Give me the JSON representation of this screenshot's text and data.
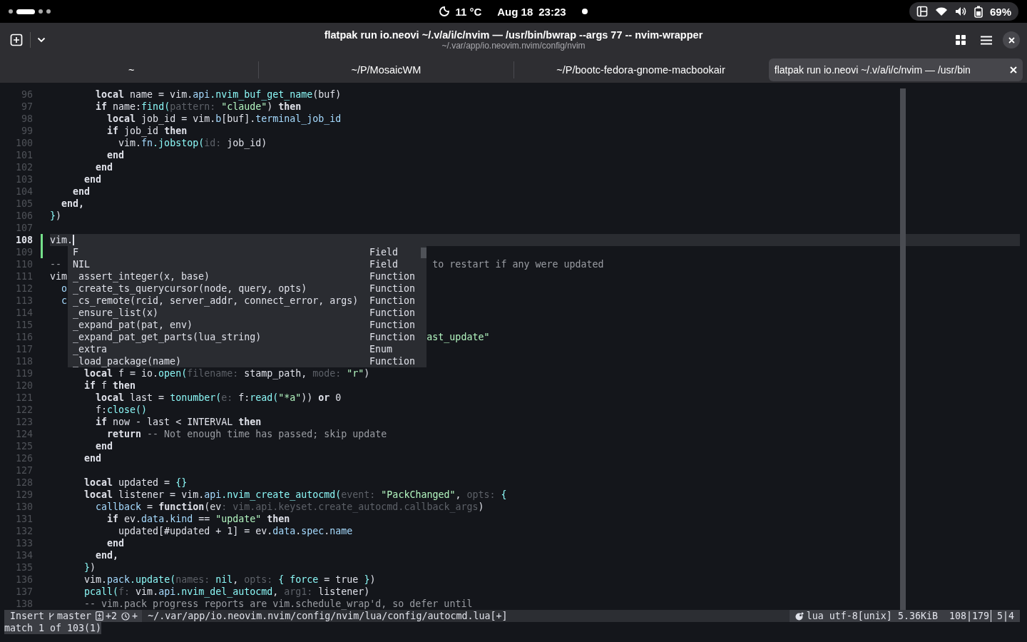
{
  "top_bar": {
    "weather": "11 °C",
    "date": "Aug 18",
    "time": "23:23",
    "battery": "69%"
  },
  "window": {
    "title": "flatpak run io.neovi ~/.v/a/i/c/nvim — /usr/bin/bwrap --args 77 -- nvim-wrapper",
    "subtitle": "~/.var/app/io.neovim.nvim/config/nvim"
  },
  "tabs": [
    {
      "label": "~",
      "selected": false
    },
    {
      "label": "~/P/MosaicWM",
      "selected": false
    },
    {
      "label": "~/P/bootc-fedora-gnome-macbookair",
      "selected": false
    },
    {
      "label": "flatpak run io.neovi ~/.v/a/i/c/nvim — /usr/bin",
      "selected": true
    }
  ],
  "editor": {
    "lines": [
      {
        "n": "96",
        "current": false,
        "added": false,
        "tokens": [
          {
            "kind": "kw",
            "text": "        local"
          },
          {
            "kind": "plain",
            "text": " name = vim."
          },
          {
            "kind": "field",
            "text": "api"
          },
          {
            "kind": "fn",
            "text": ".nvim_buf_get_name"
          },
          {
            "kind": "plain",
            "text": "(buf)"
          }
        ]
      },
      {
        "n": "97",
        "current": false,
        "added": false,
        "tokens": [
          {
            "kind": "kw",
            "text": "        if"
          },
          {
            "kind": "plain",
            "text": " name:"
          },
          {
            "kind": "fn",
            "text": "find("
          },
          {
            "kind": "hint",
            "text": "pattern: "
          },
          {
            "kind": "str",
            "text": "\"claude\""
          },
          {
            "kind": "plain",
            "text": ") "
          },
          {
            "kind": "kw",
            "text": "then"
          }
        ]
      },
      {
        "n": "98",
        "current": false,
        "added": false,
        "tokens": [
          {
            "kind": "kw",
            "text": "          local"
          },
          {
            "kind": "plain",
            "text": " job_id = vim."
          },
          {
            "kind": "field",
            "text": "b"
          },
          {
            "kind": "plain",
            "text": "[buf]."
          },
          {
            "kind": "field",
            "text": "terminal_job_id"
          }
        ]
      },
      {
        "n": "99",
        "current": false,
        "added": false,
        "tokens": [
          {
            "kind": "kw",
            "text": "          if"
          },
          {
            "kind": "plain",
            "text": " job_id "
          },
          {
            "kind": "kw",
            "text": "then"
          }
        ]
      },
      {
        "n": "100",
        "current": false,
        "added": false,
        "tokens": [
          {
            "kind": "plain",
            "text": "            vim."
          },
          {
            "kind": "field",
            "text": "fn"
          },
          {
            "kind": "fn",
            "text": ".jobstop("
          },
          {
            "kind": "hint",
            "text": "id: "
          },
          {
            "kind": "plain",
            "text": "job_id)"
          }
        ]
      },
      {
        "n": "101",
        "current": false,
        "added": false,
        "tokens": [
          {
            "kind": "kw",
            "text": "          end"
          }
        ]
      },
      {
        "n": "102",
        "current": false,
        "added": false,
        "tokens": [
          {
            "kind": "kw",
            "text": "        end"
          }
        ]
      },
      {
        "n": "103",
        "current": false,
        "added": false,
        "tokens": [
          {
            "kind": "kw",
            "text": "      end"
          }
        ]
      },
      {
        "n": "104",
        "current": false,
        "added": false,
        "tokens": [
          {
            "kind": "kw",
            "text": "    end"
          }
        ]
      },
      {
        "n": "105",
        "current": false,
        "added": false,
        "tokens": [
          {
            "kind": "kw",
            "text": "  end,"
          }
        ]
      },
      {
        "n": "106",
        "current": false,
        "added": false,
        "tokens": [
          {
            "kind": "punct",
            "text": "}"
          },
          {
            "kind": "plain",
            "text": ")"
          }
        ]
      },
      {
        "n": "107",
        "current": false,
        "added": false
      },
      {
        "n": "108",
        "current": true,
        "added": true,
        "tokens": [
          {
            "kind": "plain",
            "text": "vim."
          }
        ]
      },
      {
        "n": "109",
        "current": false,
        "added": true
      },
      {
        "n": "110",
        "current": false,
        "added": false,
        "tokens": [
          {
            "kind": "comment",
            "text": "--"
          }
        ],
        "right": [
          {
            "kind": "comment",
            "text": " to restart if any were updated"
          }
        ]
      },
      {
        "n": "111",
        "current": false,
        "added": false,
        "tokens": [
          {
            "kind": "plain",
            "text": "vim"
          }
        ]
      },
      {
        "n": "112",
        "current": false,
        "added": false,
        "tokens": [
          {
            "kind": "field",
            "text": "  o"
          }
        ]
      },
      {
        "n": "113",
        "current": false,
        "added": false,
        "tokens": [
          {
            "kind": "field",
            "text": "  c"
          }
        ]
      },
      {
        "n": "114",
        "current": false,
        "added": false
      },
      {
        "n": "115",
        "current": false,
        "added": false
      },
      {
        "n": "116",
        "current": false,
        "added": false,
        "right": [
          {
            "kind": "str",
            "text": "ast_update\""
          }
        ]
      },
      {
        "n": "117",
        "current": false,
        "added": false
      },
      {
        "n": "118",
        "current": false,
        "added": false
      },
      {
        "n": "119",
        "current": false,
        "added": false,
        "tokens": [
          {
            "kind": "kw",
            "text": "      local"
          },
          {
            "kind": "plain",
            "text": " f = io."
          },
          {
            "kind": "fn",
            "text": "open("
          },
          {
            "kind": "hint",
            "text": "filename: "
          },
          {
            "kind": "plain",
            "text": "stamp_path, "
          },
          {
            "kind": "hint",
            "text": "mode: "
          },
          {
            "kind": "str",
            "text": "\"r\""
          },
          {
            "kind": "plain",
            "text": ")"
          }
        ]
      },
      {
        "n": "120",
        "current": false,
        "added": false,
        "tokens": [
          {
            "kind": "kw",
            "text": "      if"
          },
          {
            "kind": "plain",
            "text": " f "
          },
          {
            "kind": "kw",
            "text": "then"
          }
        ]
      },
      {
        "n": "121",
        "current": false,
        "added": false,
        "tokens": [
          {
            "kind": "kw",
            "text": "        local"
          },
          {
            "kind": "plain",
            "text": " last = "
          },
          {
            "kind": "fn",
            "text": "tonumber("
          },
          {
            "kind": "hint",
            "text": "e: "
          },
          {
            "kind": "plain",
            "text": "f:"
          },
          {
            "kind": "fn",
            "text": "read("
          },
          {
            "kind": "str",
            "text": "\"*a\""
          },
          {
            "kind": "plain",
            "text": ")) "
          },
          {
            "kind": "kw",
            "text": "or"
          },
          {
            "kind": "plain",
            "text": " 0"
          }
        ]
      },
      {
        "n": "122",
        "current": false,
        "added": false,
        "tokens": [
          {
            "kind": "plain",
            "text": "        f:"
          },
          {
            "kind": "fn",
            "text": "close()"
          }
        ]
      },
      {
        "n": "123",
        "current": false,
        "added": false,
        "tokens": [
          {
            "kind": "kw",
            "text": "        if"
          },
          {
            "kind": "plain",
            "text": " now - last < INTERVAL "
          },
          {
            "kind": "kw",
            "text": "then"
          }
        ]
      },
      {
        "n": "124",
        "current": false,
        "added": false,
        "tokens": [
          {
            "kind": "kw",
            "text": "          return"
          },
          {
            "kind": "comment",
            "text": " -- Not enough time has passed; skip update"
          }
        ]
      },
      {
        "n": "125",
        "current": false,
        "added": false,
        "tokens": [
          {
            "kind": "kw",
            "text": "        end"
          }
        ]
      },
      {
        "n": "126",
        "current": false,
        "added": false,
        "tokens": [
          {
            "kind": "kw",
            "text": "      end"
          }
        ]
      },
      {
        "n": "127",
        "current": false,
        "added": false
      },
      {
        "n": "128",
        "current": false,
        "added": false,
        "tokens": [
          {
            "kind": "kw",
            "text": "      local"
          },
          {
            "kind": "plain",
            "text": " updated = "
          },
          {
            "kind": "punct",
            "text": "{}"
          }
        ]
      },
      {
        "n": "129",
        "current": false,
        "added": false,
        "tokens": [
          {
            "kind": "kw",
            "text": "      local"
          },
          {
            "kind": "plain",
            "text": " listener = vim."
          },
          {
            "kind": "field",
            "text": "api"
          },
          {
            "kind": "fn",
            "text": ".nvim_create_autocmd("
          },
          {
            "kind": "hint",
            "text": "event: "
          },
          {
            "kind": "str",
            "text": "\"PackChanged\""
          },
          {
            "kind": "plain",
            "text": ", "
          },
          {
            "kind": "hint",
            "text": "opts: "
          },
          {
            "kind": "punct",
            "text": "{"
          }
        ]
      },
      {
        "n": "130",
        "current": false,
        "added": false,
        "tokens": [
          {
            "kind": "field",
            "text": "        callback"
          },
          {
            "kind": "plain",
            "text": " = "
          },
          {
            "kind": "kw",
            "text": "function"
          },
          {
            "kind": "plain",
            "text": "(ev"
          },
          {
            "kind": "hint",
            "text": ": vim.api.keyset.create_autocmd.callback_args"
          },
          {
            "kind": "plain",
            "text": ")"
          }
        ]
      },
      {
        "n": "131",
        "current": false,
        "added": false,
        "tokens": [
          {
            "kind": "kw",
            "text": "          if"
          },
          {
            "kind": "plain",
            "text": " ev."
          },
          {
            "kind": "field",
            "text": "data"
          },
          {
            "kind": "plain",
            "text": "."
          },
          {
            "kind": "field",
            "text": "kind"
          },
          {
            "kind": "plain",
            "text": " == "
          },
          {
            "kind": "str",
            "text": "\"update\""
          },
          {
            "kind": "kw",
            "text": " then"
          }
        ]
      },
      {
        "n": "132",
        "current": false,
        "added": false,
        "tokens": [
          {
            "kind": "plain",
            "text": "            updated[#updated + 1] = ev."
          },
          {
            "kind": "field",
            "text": "data"
          },
          {
            "kind": "plain",
            "text": "."
          },
          {
            "kind": "field",
            "text": "spec"
          },
          {
            "kind": "plain",
            "text": "."
          },
          {
            "kind": "field",
            "text": "name"
          }
        ]
      },
      {
        "n": "133",
        "current": false,
        "added": false,
        "tokens": [
          {
            "kind": "kw",
            "text": "          end"
          }
        ]
      },
      {
        "n": "134",
        "current": false,
        "added": false,
        "tokens": [
          {
            "kind": "kw",
            "text": "        end,"
          }
        ]
      },
      {
        "n": "135",
        "current": false,
        "added": false,
        "tokens": [
          {
            "kind": "punct",
            "text": "      }"
          },
          {
            "kind": "plain",
            "text": ")"
          }
        ]
      },
      {
        "n": "136",
        "current": false,
        "added": false,
        "tokens": [
          {
            "kind": "plain",
            "text": "      vim."
          },
          {
            "kind": "field",
            "text": "pack"
          },
          {
            "kind": "fn",
            "text": ".update("
          },
          {
            "kind": "hint",
            "text": "names: "
          },
          {
            "kind": "fn",
            "text": "nil"
          },
          {
            "kind": "plain",
            "text": ", "
          },
          {
            "kind": "hint",
            "text": "opts: "
          },
          {
            "kind": "punct",
            "text": "{ force"
          },
          {
            "kind": "plain",
            "text": " = true "
          },
          {
            "kind": "punct",
            "text": "}"
          },
          {
            "kind": "plain",
            "text": ")"
          }
        ]
      },
      {
        "n": "137",
        "current": false,
        "added": false,
        "tokens": [
          {
            "kind": "fn",
            "text": "      pcall("
          },
          {
            "kind": "hint",
            "text": "f: "
          },
          {
            "kind": "plain",
            "text": "vim."
          },
          {
            "kind": "field",
            "text": "api"
          },
          {
            "kind": "fn",
            "text": ".nvim_del_autocmd"
          },
          {
            "kind": "plain",
            "text": ", "
          },
          {
            "kind": "hint",
            "text": "arg1: "
          },
          {
            "kind": "plain",
            "text": "listener)"
          }
        ]
      },
      {
        "n": "138",
        "current": false,
        "added": false,
        "tokens": [
          {
            "kind": "comment",
            "text": "      -- vim.pack progress reports are vim.schedule_wrap'd, so defer until"
          }
        ]
      }
    ],
    "completion": [
      {
        "name": "F",
        "type": "Field",
        "selected": false
      },
      {
        "name": "NIL",
        "type": "Field",
        "selected": false
      },
      {
        "name": "_assert_integer(x, base)",
        "type": "Function",
        "selected": false
      },
      {
        "name": "_create_ts_querycursor(node, query, opts)",
        "type": "Function",
        "selected": false
      },
      {
        "name": "_cs_remote(rcid, server_addr, connect_error, args)",
        "type": "Function",
        "selected": false
      },
      {
        "name": "_ensure_list(x)",
        "type": "Function",
        "selected": false
      },
      {
        "name": "_expand_pat(pat, env)",
        "type": "Function",
        "selected": false
      },
      {
        "name": "_expand_pat_get_parts(lua_string)",
        "type": "Function",
        "selected": false
      },
      {
        "name": "_extra",
        "type": "Enum",
        "selected": false
      },
      {
        "name": "_load_package(name)",
        "type": "Function",
        "selected": false
      }
    ]
  },
  "status_line": {
    "mode": "Insert",
    "branch": "master",
    "changes": "+2",
    "staged": "+",
    "path": "~/.var/app/io.neovim.nvim/config/nvim/lua/config/autocmd.lua[+]",
    "filetype": "lua",
    "encoding": "utf-8[unix]",
    "size": "5.36KiB",
    "position": "108|179",
    "column": "5|4"
  },
  "command_line": {
    "message": "match 1 of 103(1)"
  }
}
